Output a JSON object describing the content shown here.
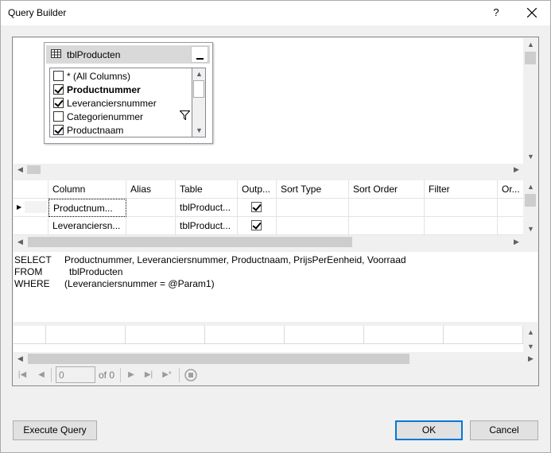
{
  "window": {
    "title": "Query Builder",
    "help_label": "?"
  },
  "diagram": {
    "table_name": "tblProducten",
    "columns": [
      {
        "label": "* (All Columns)",
        "checked": false,
        "bold": false
      },
      {
        "label": "Productnummer",
        "checked": true,
        "bold": true
      },
      {
        "label": "Leveranciersnummer",
        "checked": true,
        "bold": false
      },
      {
        "label": "Categorienummer",
        "checked": false,
        "bold": false
      },
      {
        "label": "Productnaam",
        "checked": true,
        "bold": false
      }
    ],
    "filter_icon": "filter-icon"
  },
  "grid": {
    "headers": [
      "Column",
      "Alias",
      "Table",
      "Outp...",
      "Sort Type",
      "Sort Order",
      "Filter",
      "Or..."
    ],
    "rows": [
      {
        "column": "Productnum...",
        "alias": "",
        "table": "tblProduct...",
        "output": true
      },
      {
        "column": "Leveranciersn...",
        "alias": "",
        "table": "tblProduct...",
        "output": true
      }
    ]
  },
  "sql": {
    "lines": [
      {
        "keyword": "SELECT",
        "text": "Productnummer, Leveranciersnummer, Productnaam, PrijsPerEenheid, Voorraad"
      },
      {
        "keyword": "FROM",
        "text": "tblProducten"
      },
      {
        "keyword": "WHERE",
        "text": "(Leveranciersnummer = @Param1)"
      }
    ]
  },
  "navigator": {
    "position_value": "0",
    "of_label": "of 0"
  },
  "buttons": {
    "execute": "Execute Query",
    "ok": "OK",
    "cancel": "Cancel"
  },
  "colors": {
    "accent": "#0078d7",
    "frame_bg": "#f0f0f0"
  }
}
